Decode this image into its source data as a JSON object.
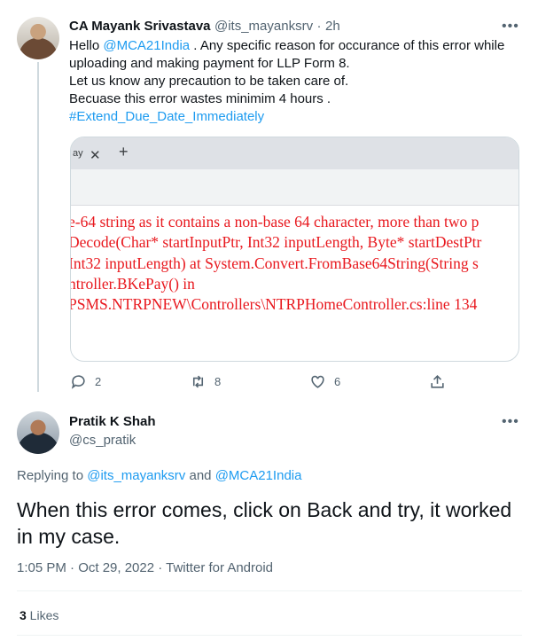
{
  "tweet1": {
    "display_name": "CA Mayank Srivastava",
    "handle": "@its_mayanksrv",
    "separator": "·",
    "time": "2h",
    "more": "•••",
    "lines": [
      {
        "pre": "Hello ",
        "mention": "@MCA21India",
        "post": " . Any specific reason for occurance of this error while"
      },
      {
        "text": "uploading and making payment for LLP Form 8."
      },
      {
        "text": "Let us know any precaution to be taken care of."
      },
      {
        "text": "Becuase this error wastes minimim 4 hours ."
      }
    ],
    "hashtag": "#Extend_Due_Date_Immediately",
    "image": {
      "tab_label": "ay",
      "tab_close": "✕",
      "new_tab": "+",
      "error_lines": [
        "e-64 string as it contains a non-base 64 character, more than two p",
        "Decode(Char* startInputPtr, Int32 inputLength, Byte* startDestPtr",
        "Int32 inputLength) at System.Convert.FromBase64String(String s",
        "ntroller.BKePay() in",
        "PSMS.NTRPNEW\\Controllers\\NTRPHomeController.cs:line 134"
      ]
    },
    "actions": {
      "replies": "2",
      "retweets": "8",
      "likes": "6"
    }
  },
  "tweet2": {
    "display_name": "Pratik K Shah",
    "handle": "@cs_pratik",
    "more": "•••",
    "replying_prefix": "Replying to ",
    "replying_user1": "@its_mayanksrv",
    "replying_and": " and ",
    "replying_user2": "@MCA21India",
    "text_line1": "When this error comes, click on Back and try, it worked",
    "text_line2": "in my case.",
    "meta": "1:05 PM · Oct 29, 2022 · Twitter for Android",
    "like_count": "3",
    "like_label": " Likes"
  },
  "colors": {
    "accent": "#1d9bf0",
    "muted": "#536471",
    "error_red": "#e8181e"
  }
}
